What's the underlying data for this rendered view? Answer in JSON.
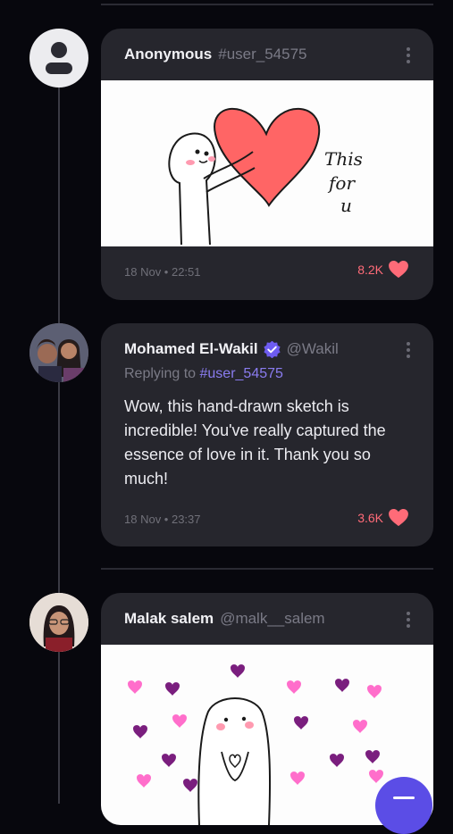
{
  "posts": [
    {
      "name": "Anonymous",
      "handle": "#user_54575",
      "timestamp": "18 Nov • 22:51",
      "likes": "8.2K",
      "media_text": [
        "This",
        "for",
        "u"
      ]
    },
    {
      "name": "Mohamed El-Wakil",
      "handle": "@Wakil",
      "verified": true,
      "replying_prefix": "Replying to",
      "replying_to": "#user_54575",
      "text": "Wow, this hand-drawn sketch is incredible! You've really captured the essence of love in it. Thank you so much!",
      "timestamp": "18 Nov • 23:37",
      "likes": "3.6K"
    },
    {
      "name": "Malak salem",
      "handle": "@malk__salem"
    }
  ],
  "colors": {
    "background": "#07070d",
    "card": "#26262d",
    "accent": "#5b4de6",
    "like": "#ff6b78",
    "mention": "#8a7cf0"
  },
  "icons": [
    "more-vertical-icon",
    "heart-icon",
    "verified-badge-icon",
    "default-user-icon",
    "compose-icon"
  ]
}
